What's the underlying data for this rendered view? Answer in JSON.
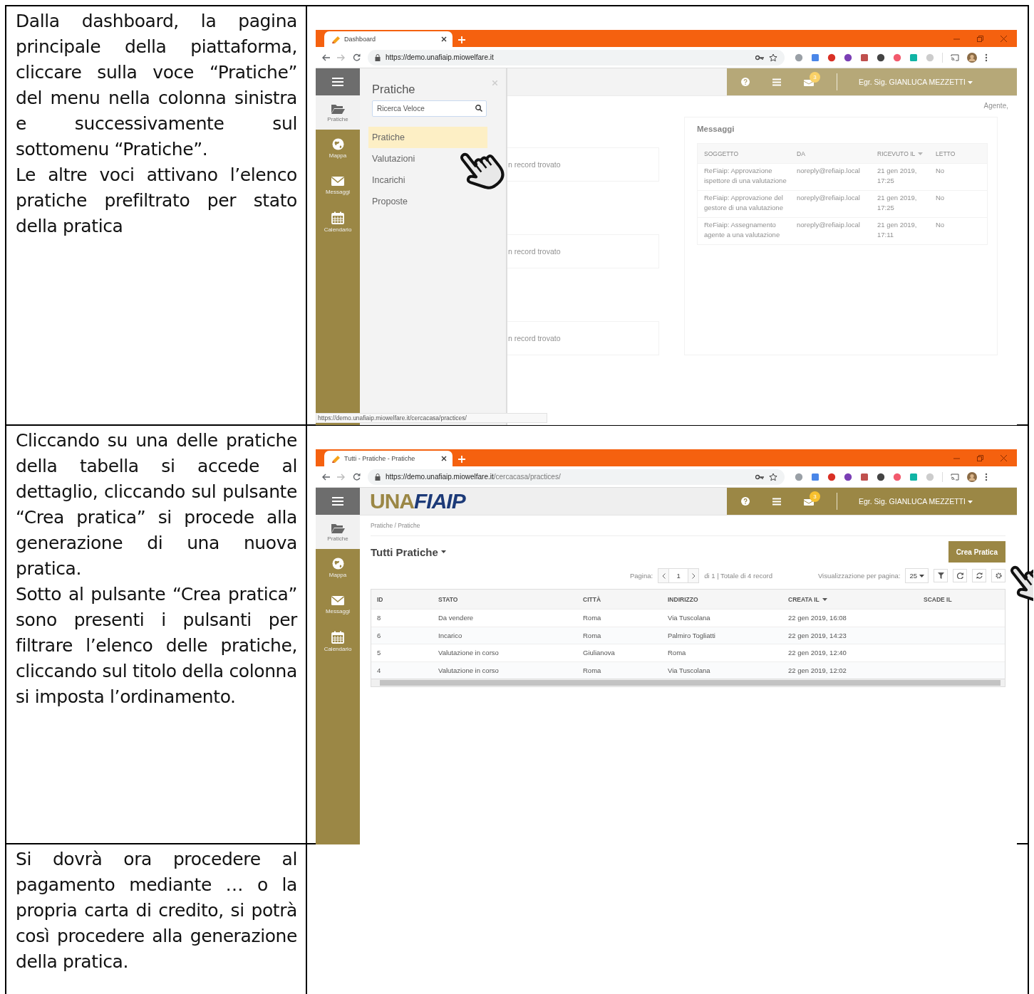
{
  "document_rows": [
    {
      "paragraphs": [
        "Dalla dashboard, la pagina principale della piattaforma, cliccare sulla voce “Pratiche” del menu nella colonna sinistra e successivamente sul sottomenu “Pratiche”.",
        "Le altre voci attivano l’elenco pratiche prefiltrato per stato della pratica"
      ],
      "screenshot": {
        "kind": "dashboard",
        "tab_title": "Dashboard",
        "url_host": "https://demo.unafiaip.miowelfare.it",
        "sidebar": [
          {
            "label": "Pratiche",
            "selected": true
          },
          {
            "label": "Mappa",
            "selected": false
          },
          {
            "label": "Messaggi",
            "selected": false
          },
          {
            "label": "Calendario",
            "selected": false
          }
        ],
        "topbar": {
          "badge": "3",
          "user": "Egr. Sig. GIANLUCA MEZZETTI"
        },
        "flyout": {
          "title": "Pratiche",
          "search_placeholder": "Ricerca Veloce",
          "items": [
            {
              "label": "Pratiche",
              "selected": true
            },
            {
              "label": "Valutazioni",
              "selected": false
            },
            {
              "label": "Incarichi",
              "selected": false
            },
            {
              "label": "Proposte",
              "selected": false
            }
          ]
        },
        "greeting": "Agente,",
        "cards": [
          "n record trovato",
          "n record trovato",
          "n record trovato"
        ],
        "messages": {
          "title": "Messaggi",
          "columns": [
            {
              "label": "SOGGETTO",
              "sorted": false
            },
            {
              "label": "DA",
              "sorted": false
            },
            {
              "label": "RICEVUTO IL",
              "sorted": true
            },
            {
              "label": "LETTO",
              "sorted": false
            }
          ],
          "rows": [
            [
              "ReFiaip: Approvazione ispettore di una valutazione",
              "noreply@refiaip.local",
              "21 gen 2019, 17:25",
              "No"
            ],
            [
              "ReFiaip: Approvazione del gestore di una valutazione",
              "noreply@refiaip.local",
              "21 gen 2019, 17:25",
              "No"
            ],
            [
              "ReFiaip: Assegnamento agente a una valutazione",
              "noreply@refiaip.local",
              "21 gen 2019, 17:11",
              "No"
            ]
          ]
        },
        "status_url": "https://demo.unafiaip.miowelfare.it/cercacasa/practices/"
      }
    },
    {
      "paragraphs": [
        "Cliccando su una delle pratiche della tabella si accede al dettaglio, cliccando sul pulsante “Crea pratica” si procede alla generazione di una nuova pratica.",
        "Sotto al pulsante “Crea pratica” sono presenti i pulsanti per filtrare l’elenco delle pratiche, cliccando sul titolo della colonna si imposta l’ordinamento."
      ],
      "screenshot": {
        "kind": "list",
        "tab_title": "Tutti - Pratiche - Pratiche",
        "url_host": "https://demo.unafiaip.miowelfare.it",
        "url_path": "/cercacasa/practices/",
        "sidebar": [
          {
            "label": "Pratiche",
            "selected": true
          },
          {
            "label": "Mappa",
            "selected": false
          },
          {
            "label": "Messaggi",
            "selected": false
          },
          {
            "label": "Calendario",
            "selected": false
          }
        ],
        "logo": {
          "first": "UNA",
          "second": "FIAIP"
        },
        "topbar": {
          "badge": "3",
          "user": "Egr. Sig. GIANLUCA MEZZETTI"
        },
        "breadcrumb": "Pratiche / Pratiche",
        "title": "Tutti Pratiche",
        "create_button": "Crea Pratica",
        "pager": {
          "label": "Pagina:",
          "page": "1",
          "summary": "di 1 | Totale di 4 record",
          "per_page_label": "Visualizzazione per pagina:",
          "per_page": "25"
        },
        "table": {
          "columns": [
            {
              "label": "ID",
              "sorted": false
            },
            {
              "label": "STATO",
              "sorted": false
            },
            {
              "label": "CITTÀ",
              "sorted": false
            },
            {
              "label": "INDIRIZZO",
              "sorted": false
            },
            {
              "label": "CREATA IL",
              "sorted": true
            },
            {
              "label": "SCADE IL",
              "sorted": false
            }
          ],
          "rows": [
            [
              "8",
              "Da vendere",
              "Roma",
              "Via Tuscolana",
              "22 gen 2019, 16:08"
            ],
            [
              "6",
              "Incarico",
              "Roma",
              "Palmiro Togliatti",
              "22 gen 2019, 14:23"
            ],
            [
              "5",
              "Valutazione in corso",
              "Giulianova",
              "Roma",
              "22 gen 2019, 12:40"
            ],
            [
              "4",
              "Valutazione in corso",
              "Roma",
              "Via Tuscolana",
              "22 gen 2019, 12:02"
            ]
          ]
        }
      }
    },
    {
      "paragraphs": [
        "Si dovrà ora procedere al pagamento mediante … o la propria carta di credito, si potrà così procedere alla generazione della pratica."
      ]
    }
  ]
}
